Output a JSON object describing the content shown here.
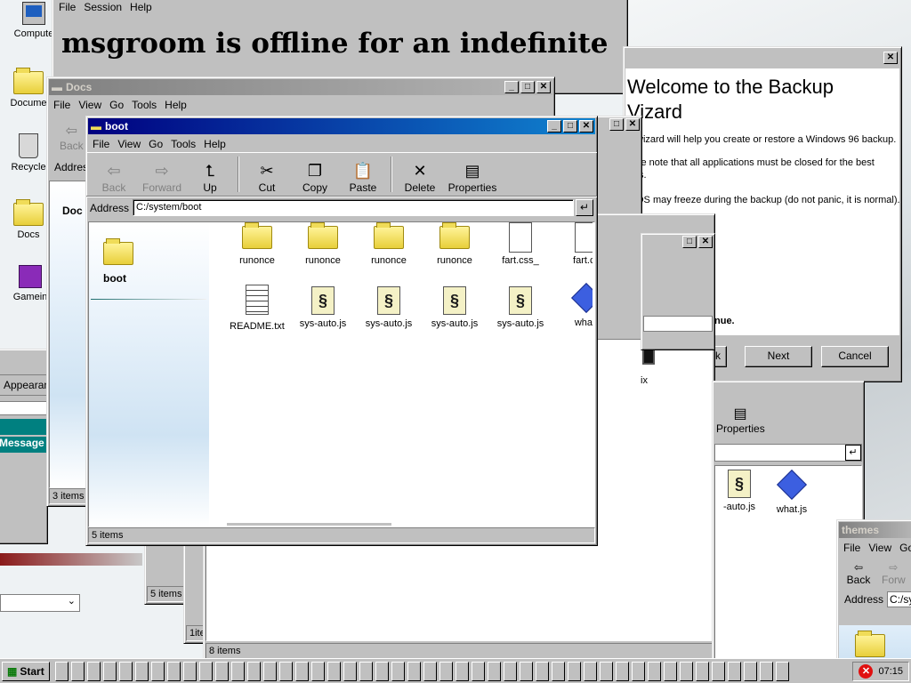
{
  "desktop": {
    "icons": [
      {
        "label": "Compute",
        "icon": "computer-icon"
      },
      {
        "label": "Docume",
        "icon": "documents-folder-icon"
      },
      {
        "label": "Recycle",
        "icon": "recycle-bin-icon"
      },
      {
        "label": "Docs",
        "icon": "folder-icon"
      },
      {
        "label": "Gamein",
        "icon": "game-icon"
      }
    ]
  },
  "msgroom": {
    "menu": [
      "File",
      "Session",
      "Help"
    ],
    "message": "msgroom is offline for an indefinite"
  },
  "backup_wizard": {
    "heading_line1": "Welcome to the Backup",
    "heading_line2": "Vizard",
    "text1": "wizard will help you create or restore a Windows 96 backup.",
    "text2a": "se note that all applications must be closed for the best",
    "text2b": "ts.",
    "text3": "OS may freeze during the backup (do not panic, it is normal).",
    "continue_text": "nue.",
    "back_label": "k",
    "next_label": "Next",
    "cancel_label": "Cancel"
  },
  "docs_window": {
    "title": "Docs",
    "menu": [
      "File",
      "View",
      "Go",
      "Tools",
      "Help"
    ],
    "back_label": "Back",
    "address_label": "Addres",
    "side_label": "Doc",
    "status": "3 items"
  },
  "left_panel": {
    "tab_label": "Appearan",
    "message_label": "Message",
    "status_5": "5 items",
    "status_1": "1ite"
  },
  "mid_window": {
    "properties_label": "Properties",
    "files": [
      {
        "label": "-auto.js",
        "icon": "js-script-icon"
      },
      {
        "label": "what.js",
        "icon": "diamond-icon"
      }
    ],
    "ix_label": "ix",
    "status": "8 items"
  },
  "themes_window": {
    "title": "themes",
    "menu": [
      "File",
      "View",
      "Go"
    ],
    "back_label": "Back",
    "forward_label": "Forw",
    "address_label": "Address",
    "address_value": "C:/sys"
  },
  "boot_window": {
    "title": "boot",
    "menu": [
      "File",
      "View",
      "Go",
      "Tools",
      "Help"
    ],
    "toolbar": [
      {
        "label": "Back",
        "icon": "back-arrow-icon",
        "enabled": false
      },
      {
        "label": "Forward",
        "icon": "forward-arrow-icon",
        "enabled": false
      },
      {
        "label": "Up",
        "icon": "up-folder-icon",
        "enabled": true
      },
      {
        "label": "Cut",
        "icon": "scissors-icon",
        "enabled": true
      },
      {
        "label": "Copy",
        "icon": "copy-icon",
        "enabled": true
      },
      {
        "label": "Paste",
        "icon": "paste-icon",
        "enabled": true
      },
      {
        "label": "Delete",
        "icon": "delete-x-icon",
        "enabled": true
      },
      {
        "label": "Properties",
        "icon": "properties-icon",
        "enabled": true
      }
    ],
    "address_label": "Address",
    "address_value": "C:/system/boot",
    "side_title": "boot",
    "files": [
      {
        "label": "runonce",
        "icon": "folder-icon"
      },
      {
        "label": "runonce",
        "icon": "folder-icon"
      },
      {
        "label": "runonce",
        "icon": "folder-icon"
      },
      {
        "label": "runonce",
        "icon": "folder-icon"
      },
      {
        "label": "fart.css_",
        "icon": "file-icon"
      },
      {
        "label": "fart.cs",
        "icon": "file-icon"
      },
      {
        "label": "README.txt",
        "icon": "text-file-icon"
      },
      {
        "label": "sys-auto.js",
        "icon": "js-script-icon"
      },
      {
        "label": "sys-auto.js",
        "icon": "js-script-icon"
      },
      {
        "label": "sys-auto.js",
        "icon": "js-script-icon"
      },
      {
        "label": "sys-auto.js",
        "icon": "js-script-icon"
      },
      {
        "label": "what.",
        "icon": "diamond-icon"
      }
    ],
    "status": "5 items"
  },
  "taskbar": {
    "start_label": "Start",
    "clock": "07:15",
    "accent": "#000080"
  }
}
